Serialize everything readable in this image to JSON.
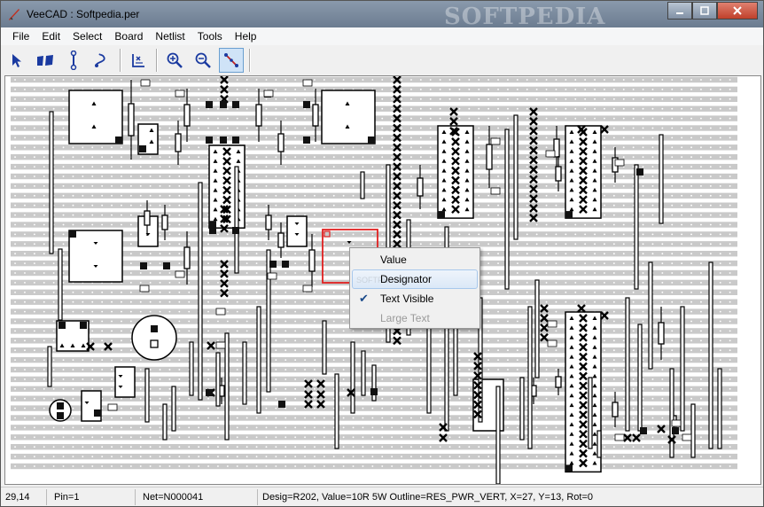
{
  "window": {
    "title": "VeeCAD : Softpedia.per",
    "watermark": "SOFTPEDIA"
  },
  "menu": [
    "File",
    "Edit",
    "Select",
    "Board",
    "Netlist",
    "Tools",
    "Help"
  ],
  "toolbar": [
    {
      "name": "select-arrow",
      "icon": "arrow-icon"
    },
    {
      "name": "component-place",
      "icon": "component-icon"
    },
    {
      "name": "link-tool",
      "icon": "link-icon"
    },
    {
      "name": "wire-tool",
      "icon": "wire-icon"
    },
    {
      "name": "break-track",
      "icon": "break-icon"
    },
    {
      "name": "zoom-in",
      "icon": "zoom-in-icon"
    },
    {
      "name": "zoom-out",
      "icon": "zoom-out-icon"
    },
    {
      "name": "connection-tool",
      "icon": "connection-icon",
      "active": true
    }
  ],
  "context_menu": {
    "watermark": "SOFTPEDIA",
    "items": [
      {
        "label": "Value",
        "checked": false,
        "highlighted": false,
        "disabled": false
      },
      {
        "label": "Designator",
        "checked": false,
        "highlighted": true,
        "disabled": false
      },
      {
        "label": "Text Visible",
        "checked": true,
        "highlighted": false,
        "disabled": false
      },
      {
        "label": "Large Text",
        "checked": false,
        "highlighted": false,
        "disabled": true
      }
    ]
  },
  "status": {
    "coords": "29,14",
    "pin": "Pin=1",
    "net": "Net=N000041",
    "desc": "Desig=R202, Value=10R 5W Outline=RES_PWR_VERT, X=27, Y=13, Rot=0"
  },
  "colors": {
    "strip": "#c9c9c9",
    "selection": "#e02020",
    "active_tool_bg": "#cfe3f7"
  }
}
